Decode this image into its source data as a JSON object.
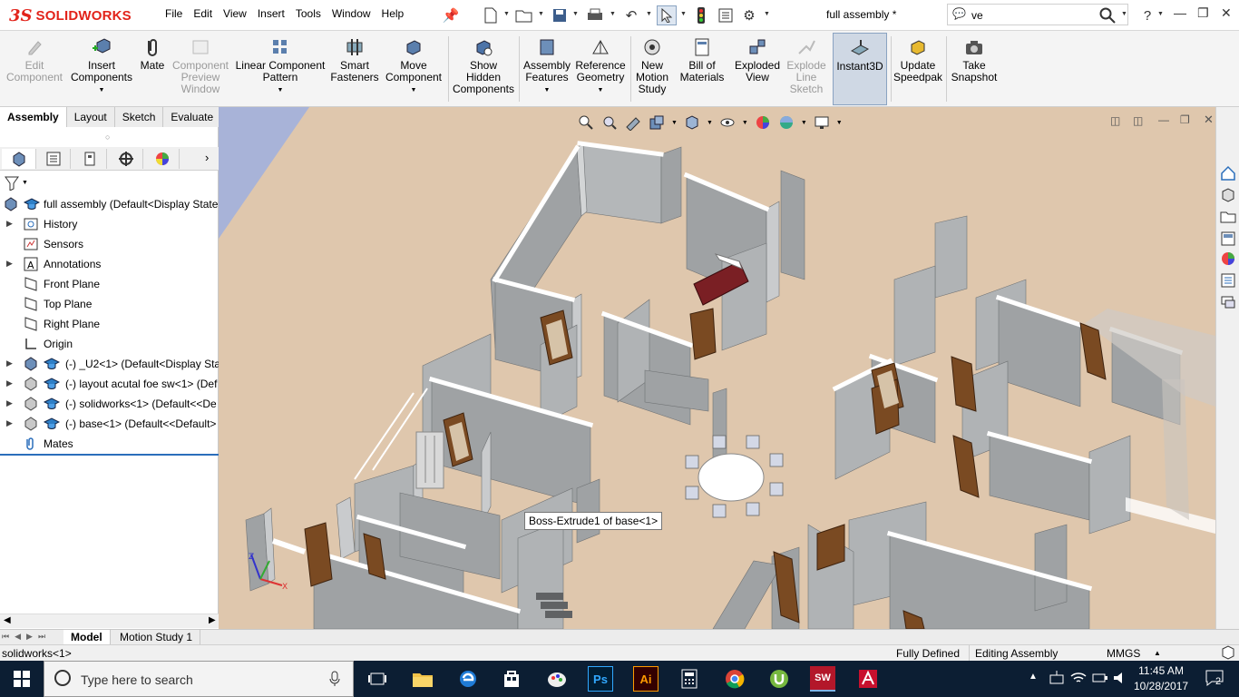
{
  "app": {
    "brand": "SOLIDWORKS",
    "document_title": "full assembly *"
  },
  "menu": [
    "File",
    "Edit",
    "View",
    "Insert",
    "Tools",
    "Window",
    "Help"
  ],
  "search": {
    "value": "ve"
  },
  "ribbon": {
    "buttons": [
      {
        "id": "edit-component",
        "label": "Edit\nComponent",
        "enabled": false
      },
      {
        "id": "insert-components",
        "label": "Insert\nComponents",
        "enabled": true
      },
      {
        "id": "mate",
        "label": "Mate",
        "enabled": true
      },
      {
        "id": "component-preview-window",
        "label": "Component\nPreview\nWindow",
        "enabled": false
      },
      {
        "id": "linear-component-pattern",
        "label": "Linear Component\nPattern",
        "enabled": true
      },
      {
        "id": "smart-fasteners",
        "label": "Smart\nFasteners",
        "enabled": true
      },
      {
        "id": "move-component",
        "label": "Move\nComponent",
        "enabled": true
      },
      {
        "id": "show-hidden-components",
        "label": "Show\nHidden\nComponents",
        "enabled": true
      },
      {
        "id": "assembly-features",
        "label": "Assembly\nFeatures",
        "enabled": true
      },
      {
        "id": "reference-geometry",
        "label": "Reference\nGeometry",
        "enabled": true
      },
      {
        "id": "new-motion-study",
        "label": "New\nMotion\nStudy",
        "enabled": true
      },
      {
        "id": "bill-of-materials",
        "label": "Bill of\nMaterials",
        "enabled": true
      },
      {
        "id": "exploded-view",
        "label": "Exploded\nView",
        "enabled": true
      },
      {
        "id": "explode-line-sketch",
        "label": "Explode\nLine\nSketch",
        "enabled": false
      },
      {
        "id": "instant3d",
        "label": "Instant3D",
        "enabled": true
      },
      {
        "id": "update-speedpak",
        "label": "Update\nSpeedpak",
        "enabled": true
      },
      {
        "id": "take-snapshot",
        "label": "Take\nSnapshot",
        "enabled": true
      }
    ]
  },
  "command_tabs": [
    "Assembly",
    "Layout",
    "Sketch",
    "Evaluate"
  ],
  "tree": [
    {
      "label": "full assembly  (Default<Display State",
      "expander": false
    },
    {
      "label": "History",
      "expander": true
    },
    {
      "label": "Sensors",
      "expander": false
    },
    {
      "label": "Annotations",
      "expander": true
    },
    {
      "label": "Front Plane",
      "expander": false
    },
    {
      "label": "Top Plane",
      "expander": false
    },
    {
      "label": "Right Plane",
      "expander": false
    },
    {
      "label": "Origin",
      "expander": false
    },
    {
      "label": "(-) _U2<1> (Default<Display Sta",
      "expander": true
    },
    {
      "label": "(-) layout acutal foe sw<1> (Def",
      "expander": true
    },
    {
      "label": "(-) solidworks<1> (Default<<De",
      "expander": true
    },
    {
      "label": "(-) base<1> (Default<<Default>",
      "expander": true
    },
    {
      "label": "Mates",
      "expander": false
    }
  ],
  "viewport": {
    "tooltip": "Boss-Extrude1 of base<1>"
  },
  "bottom_tabs": [
    "Model",
    "Motion Study 1"
  ],
  "status": {
    "left": "solidworks<1>",
    "state": "Fully Defined",
    "mode": "Editing Assembly",
    "units": "MMGS"
  },
  "taskbar": {
    "search_placeholder": "Type here to search",
    "time": "11:45 AM",
    "date": "10/28/2017",
    "notifications": "2"
  },
  "colors": {
    "brand": "#e2231a",
    "viewport_floor": "#dfc7ad",
    "wall": "#9fa2a4",
    "taskbar": "#0c1e33"
  }
}
